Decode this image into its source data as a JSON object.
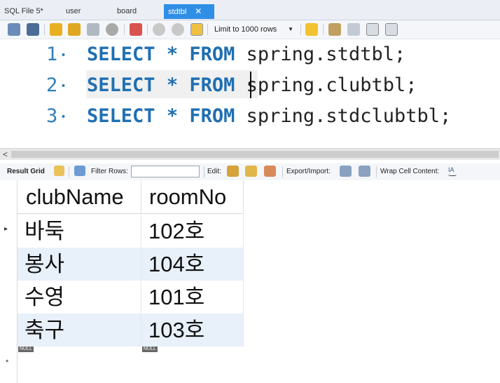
{
  "tabs": [
    {
      "label": "SQL File 5*"
    },
    {
      "label": "user"
    },
    {
      "label": "board"
    },
    {
      "label": "stdtbl",
      "close": "✕"
    }
  ],
  "toolbar": {
    "limit_label": "Limit to 1000 rows"
  },
  "editor": {
    "lines": [
      {
        "num": "1",
        "keyword1": "SELECT",
        "star": "*",
        "keyword2": "FROM",
        "rest": "spring.stdtbl;"
      },
      {
        "num": "2",
        "keyword1": "SELECT",
        "star": "*",
        "keyword2": "FROM",
        "rest": "spring.clubtbl;"
      },
      {
        "num": "3",
        "keyword1": "SELECT",
        "star": "*",
        "keyword2": "FROM",
        "rest": "spring.stdclubtbl;"
      }
    ]
  },
  "scroll": {
    "left_arrow": "<"
  },
  "result_toolbar": {
    "result_grid": "Result Grid",
    "filter_rows": "Filter Rows:",
    "edit": "Edit:",
    "export_import": "Export/Import:",
    "wrap_cell": "Wrap Cell Content:"
  },
  "grid": {
    "columns": [
      "clubName",
      "roomNo"
    ],
    "rows": [
      [
        "바둑",
        "102호"
      ],
      [
        "봉사",
        "104호"
      ],
      [
        "수영",
        "101호"
      ],
      [
        "축구",
        "103호"
      ]
    ],
    "null_label": "NULL",
    "new_row_marker": "*",
    "current_row_marker": "▸"
  }
}
